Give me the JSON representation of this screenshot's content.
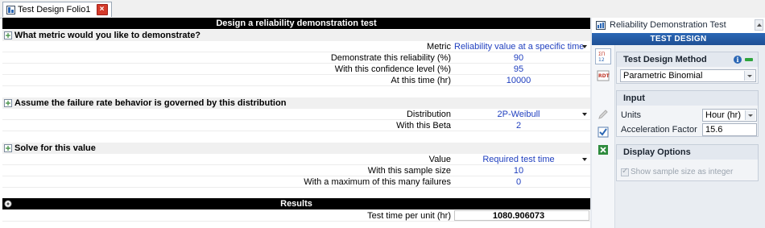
{
  "tab": {
    "title": "Test Design Folio1",
    "close_icon": "close-icon"
  },
  "main": {
    "header": "Design a reliability demonstration test",
    "sections": [
      {
        "title": "What metric would you like to demonstrate?",
        "rows": [
          {
            "label": "Metric",
            "value": "Reliability value at a specific time",
            "dropdown": true
          },
          {
            "label": "Demonstrate this reliability (%)",
            "value": "90"
          },
          {
            "label": "With this confidence level (%)",
            "value": "95"
          },
          {
            "label": "At this time (hr)",
            "value": "10000"
          }
        ]
      },
      {
        "title": "Assume the failure rate behavior is governed by this distribution",
        "rows": [
          {
            "label": "Distribution",
            "value": "2P-Weibull",
            "dropdown": true
          },
          {
            "label": "With this Beta",
            "value": "2"
          }
        ]
      },
      {
        "title": "Solve for this value",
        "rows": [
          {
            "label": "Value",
            "value": "Required test time",
            "dropdown": true
          },
          {
            "label": "With this sample size",
            "value": "10"
          },
          {
            "label": "With a maximum of this many failures",
            "value": "0"
          }
        ]
      }
    ],
    "results": {
      "title": "Results",
      "rows": [
        {
          "label": "Test time per unit (hr)",
          "value": "1080.906073"
        }
      ]
    }
  },
  "panel": {
    "title": "Reliability Demonstration Test",
    "band": "TEST DESIGN",
    "method": {
      "title": "Test Design Method",
      "selected": "Parametric Binomial"
    },
    "input": {
      "title": "Input",
      "units_label": "Units",
      "units_value": "Hour (hr)",
      "accel_label": "Acceleration Factor",
      "accel_value": "15.6"
    },
    "display": {
      "title": "Display Options",
      "checkbox_label": "Show sample size as integer",
      "checked": true
    }
  },
  "colors": {
    "accent": "#1e4f94",
    "value_text": "#1f3fbf",
    "close": "#d43a2a"
  }
}
